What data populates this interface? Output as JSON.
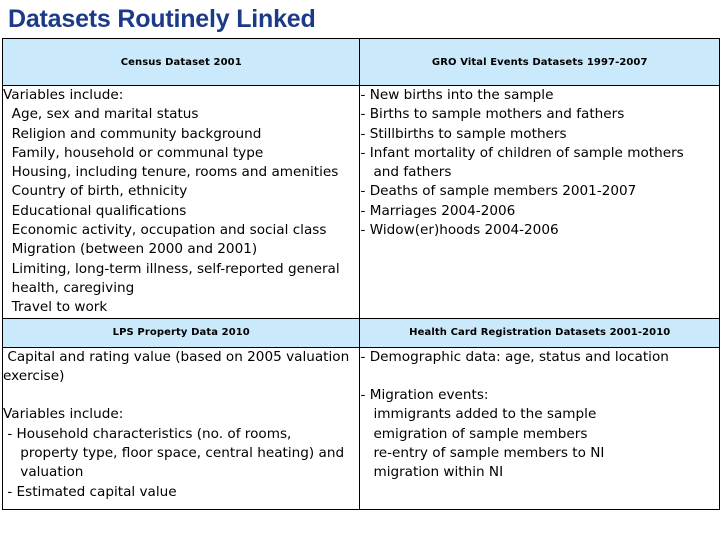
{
  "slide": {
    "title": "Datasets Routinely Linked",
    "title_color": "#1b3a87",
    "header_fill": "#cae9fb",
    "border_color": "#000000"
  },
  "table": {
    "rows": [
      {
        "headers": [
          "Census Dataset 2001",
          "GRO Vital Events Datasets 1997-2007"
        ],
        "cells": [
          {
            "lines": [
              "Variables include:",
              "  Age, sex and marital status",
              "  Religion and community background",
              "  Family, household or communal type",
              "  Housing, including tenure, rooms and amenities",
              "  Country of birth, ethnicity",
              "  Educational qualifications",
              "  Economic activity, occupation and social class",
              "  Migration (between 2000 and 2001)",
              "  Limiting, long-term illness, self-reported general",
              "  health, caregiving",
              "  Travel to work"
            ]
          },
          {
            "lines": [
              "- New births into the sample",
              "- Births to sample mothers and fathers",
              "- Stillbirths to sample mothers",
              "- Infant mortality of children of sample mothers",
              "   and fathers",
              "- Deaths of sample members 2001-2007",
              "- Marriages 2004-2006",
              "- Widow(er)hoods 2004-2006"
            ]
          }
        ]
      },
      {
        "headers": [
          "LPS Property Data 2010",
          "Health Card Registration Datasets 2001-2010"
        ],
        "cells": [
          {
            "lines": [
              " Capital and rating value (based on 2005 valuation",
              "exercise)",
              "",
              "Variables include:",
              " - Household characteristics (no. of rooms,",
              "    property type, floor space, central heating) and",
              "    valuation",
              " - Estimated capital value"
            ]
          },
          {
            "lines": [
              "- Demographic data: age, status and location",
              "",
              "- Migration events:",
              "   immigrants added to the sample",
              "   emigration of sample members",
              "   re-entry of sample members to NI",
              "   migration within NI"
            ]
          }
        ]
      }
    ]
  }
}
